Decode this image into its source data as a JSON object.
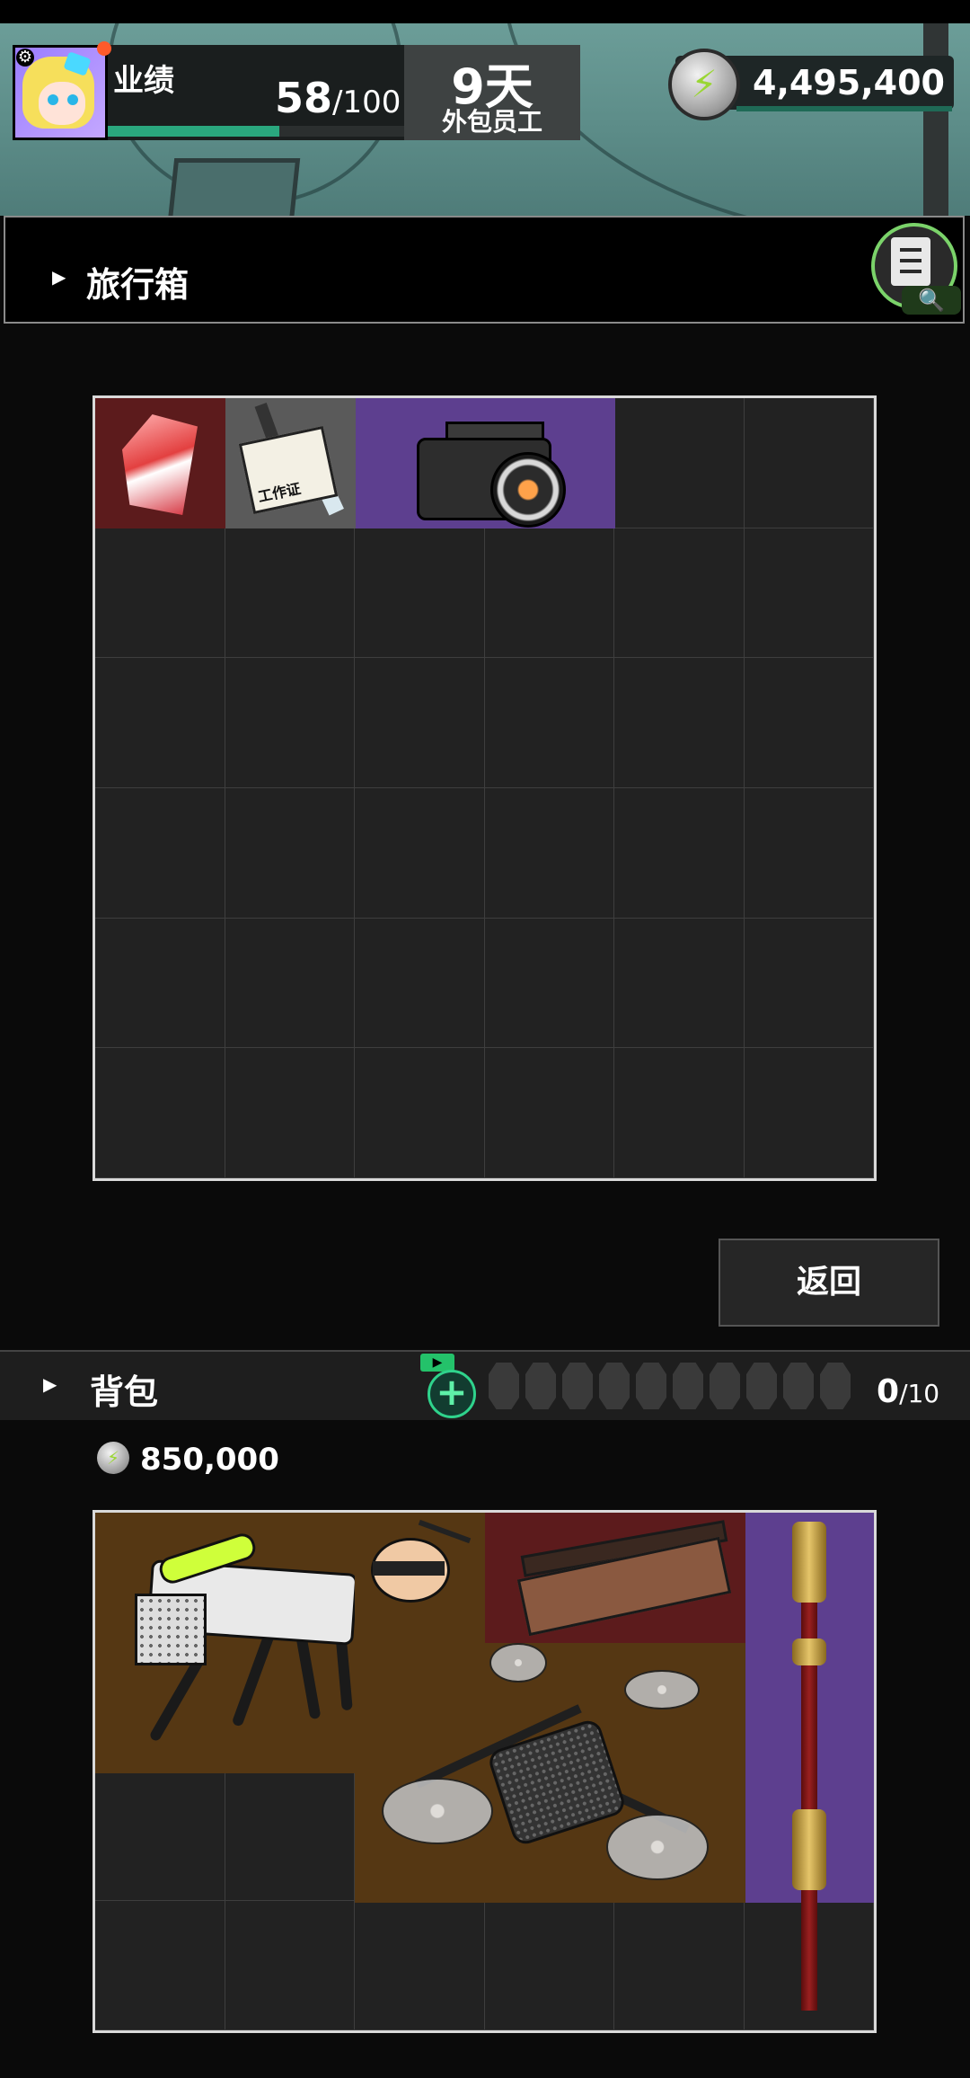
{
  "hud": {
    "performance_label": "业绩",
    "performance_current": "58",
    "performance_max": "/100",
    "performance_progress": 0.58,
    "days_value": "9天",
    "days_label": "外包员工",
    "currency_value": "4,495,400",
    "currency_icon": "lightning-coin-icon",
    "settings_icon": "gear-icon"
  },
  "suitcase": {
    "title": "旅行箱",
    "arrow_icon": "triangle-right-icon",
    "inspect_icon": "clipboard-search-icon",
    "columns": 6,
    "rows": 6,
    "items": [
      {
        "name": "red-crystal",
        "icon": "crystal-icon",
        "color": "#5c1b1c"
      },
      {
        "name": "work-badge",
        "icon": "badge-icon",
        "text": "工作证",
        "color": "#5a5a5a"
      },
      {
        "name": "camera",
        "icon": "camera-icon",
        "color": "#5d3f8f"
      }
    ]
  },
  "return_button": {
    "label": "返回"
  },
  "backpack": {
    "title": "背包",
    "arrow_icon": "triangle-right-icon",
    "add_slot_icon": "plus-icon",
    "video_icon": "play-icon",
    "slot_used": "0",
    "slot_total": "/10",
    "empty_slots": 10,
    "total_value": "850,000",
    "columns": 6,
    "rows": 4,
    "items": [
      {
        "name": "robot-dog",
        "icon": "robot-dog-icon",
        "color": "#553713"
      },
      {
        "name": "small-robot-head",
        "icon": "robot-head-icon",
        "color": "#553713"
      },
      {
        "name": "wooden-case",
        "icon": "wooden-case-icon",
        "color": "#5c1b1c"
      },
      {
        "name": "golden-staff",
        "icon": "staff-icon",
        "color": "#5d3f8f"
      },
      {
        "name": "drone",
        "icon": "drone-icon",
        "color": "#553713"
      }
    ]
  }
}
